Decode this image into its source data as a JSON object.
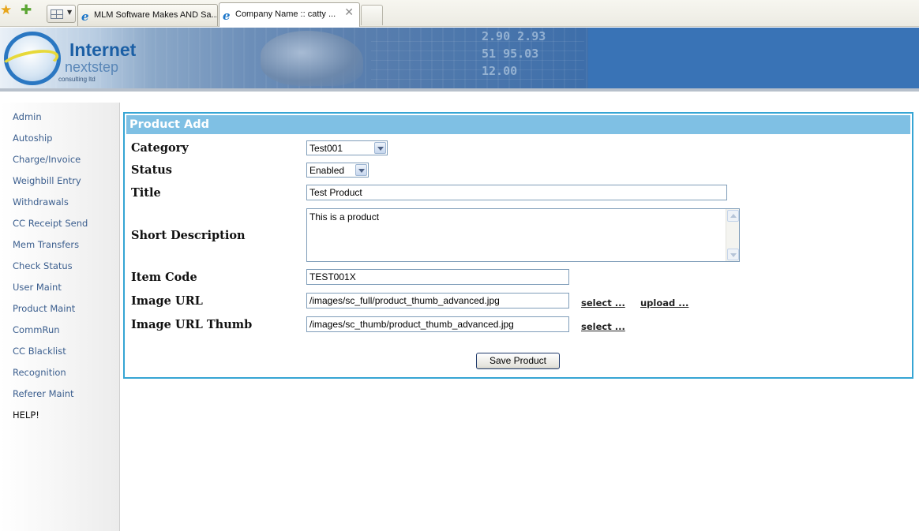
{
  "browser": {
    "tabs": [
      {
        "title": "MLM Software Makes AND Sa...",
        "active": false
      },
      {
        "title": "Company Name :: catty ...",
        "active": true
      }
    ]
  },
  "header": {
    "logo_title": "Internet",
    "logo_subtitle": "nextstep",
    "logo_tagline": "consulting ltd",
    "ticker_numbers": [
      "2.90  2.93",
      "51  95.03",
      "12.00"
    ]
  },
  "sidebar": {
    "items": [
      "Admin",
      "Autoship",
      "Charge/Invoice",
      "Weighbill Entry",
      "Withdrawals",
      "CC Receipt Send",
      "Mem Transfers",
      "Check Status",
      "User Maint",
      "Product Maint",
      "CommRun",
      "CC Blacklist",
      "Recognition",
      "Referer Maint",
      "HELP!"
    ]
  },
  "form": {
    "title": "Product Add",
    "labels": {
      "category": "Category",
      "status": "Status",
      "title": "Title",
      "short_description": "Short Description",
      "item_code": "Item Code",
      "image_url": "Image URL",
      "image_url_thumb": "Image URL Thumb"
    },
    "values": {
      "category": "Test001",
      "status": "Enabled",
      "title": "Test Product",
      "short_description": "This is a product",
      "item_code": "TEST001X",
      "image_url": "/images/sc_full/product_thumb_advanced.jpg",
      "image_url_thumb": "/images/sc_thumb/product_thumb_advanced.jpg"
    },
    "links": {
      "select": "select ...",
      "upload": "upload ..."
    },
    "save_label": "Save Product"
  },
  "colors": {
    "panel_border": "#36a5d4",
    "panel_title_bg": "#7fc0e4",
    "nav_link": "#3b5e8e",
    "header_blue": "#3973b6"
  }
}
